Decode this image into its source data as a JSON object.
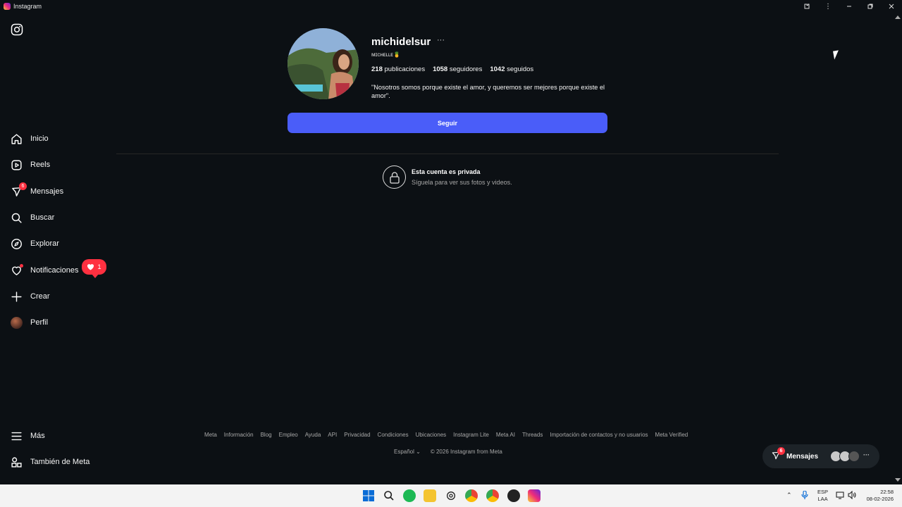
{
  "window": {
    "title": "Instagram"
  },
  "sidebar": {
    "items": [
      {
        "label": "Inicio",
        "icon": "home-icon"
      },
      {
        "label": "Reels",
        "icon": "reels-icon"
      },
      {
        "label": "Mensajes",
        "icon": "messenger-icon",
        "badge": "6"
      },
      {
        "label": "Buscar",
        "icon": "search-icon"
      },
      {
        "label": "Explorar",
        "icon": "compass-icon"
      },
      {
        "label": "Notificaciones",
        "icon": "heart-icon"
      },
      {
        "label": "Crear",
        "icon": "plus-icon"
      },
      {
        "label": "Perfil",
        "icon": "avatar"
      }
    ],
    "notification_count": "1",
    "more_label": "Más",
    "meta_label": "También de Meta"
  },
  "profile": {
    "username": "michidelsur",
    "more": "···",
    "display_name": "ᴍɪᴄʜᴇʟʟᴇ🍍",
    "stats": {
      "posts_value": "218",
      "posts_label": "publicaciones",
      "followers_value": "1058",
      "followers_label": "seguidores",
      "following_value": "1042",
      "following_label": "seguidos"
    },
    "bio": "\"Nosotros somos porque existe el amor, y queremos ser mejores porque existe el amor\".",
    "follow_label": "Seguir"
  },
  "private": {
    "title": "Esta cuenta es privada",
    "subtitle": "Síguela para ver sus fotos y videos."
  },
  "footer": {
    "links": [
      "Meta",
      "Información",
      "Blog",
      "Empleo",
      "Ayuda",
      "API",
      "Privacidad",
      "Condiciones",
      "Ubicaciones",
      "Instagram Lite",
      "Meta AI",
      "Threads",
      "Importación de contactos y no usuarios",
      "Meta Verified"
    ],
    "language": "Español",
    "copyright": "© 2026 Instagram from Meta"
  },
  "messages_bar": {
    "label": "Mensajes",
    "badge": "6"
  },
  "taskbar": {
    "lang_top": "ESP",
    "lang_bottom": "LAA",
    "time": "22:58",
    "date": "08-02-2026"
  },
  "colors": {
    "background": "#0c1014",
    "follow_button": "#4a5df9",
    "badge": "#ff3040"
  }
}
